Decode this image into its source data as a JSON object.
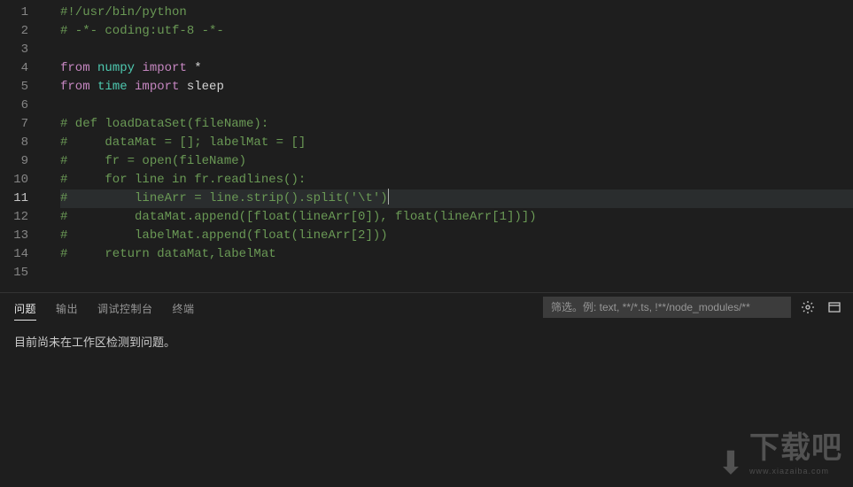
{
  "editor": {
    "active_line": 11,
    "lines": [
      {
        "n": 1,
        "seg": [
          {
            "c": "tk-comment",
            "t": "#!/usr/bin/python"
          }
        ]
      },
      {
        "n": 2,
        "seg": [
          {
            "c": "tk-comment",
            "t": "# -*- coding:utf-8 -*-"
          }
        ]
      },
      {
        "n": 3,
        "seg": [
          {
            "c": "tk-plain",
            "t": ""
          }
        ]
      },
      {
        "n": 4,
        "seg": [
          {
            "c": "tk-keyword",
            "t": "from"
          },
          {
            "c": "tk-plain",
            "t": " "
          },
          {
            "c": "tk-module",
            "t": "numpy"
          },
          {
            "c": "tk-plain",
            "t": " "
          },
          {
            "c": "tk-keyword",
            "t": "import"
          },
          {
            "c": "tk-plain",
            "t": " *"
          }
        ]
      },
      {
        "n": 5,
        "seg": [
          {
            "c": "tk-keyword",
            "t": "from"
          },
          {
            "c": "tk-plain",
            "t": " "
          },
          {
            "c": "tk-module",
            "t": "time"
          },
          {
            "c": "tk-plain",
            "t": " "
          },
          {
            "c": "tk-keyword",
            "t": "import"
          },
          {
            "c": "tk-plain",
            "t": " sleep"
          }
        ]
      },
      {
        "n": 6,
        "seg": [
          {
            "c": "tk-plain",
            "t": ""
          }
        ]
      },
      {
        "n": 7,
        "seg": [
          {
            "c": "tk-comment",
            "t": "# def loadDataSet(fileName):"
          }
        ]
      },
      {
        "n": 8,
        "seg": [
          {
            "c": "tk-comment",
            "t": "#     dataMat = []; labelMat = []"
          }
        ]
      },
      {
        "n": 9,
        "seg": [
          {
            "c": "tk-comment",
            "t": "#     fr = open(fileName)"
          }
        ]
      },
      {
        "n": 10,
        "seg": [
          {
            "c": "tk-comment",
            "t": "#     for line in fr.readlines():"
          }
        ]
      },
      {
        "n": 11,
        "seg": [
          {
            "c": "tk-comment",
            "t": "#         lineArr = line.strip().split('\\t')"
          }
        ],
        "cursor": true
      },
      {
        "n": 12,
        "seg": [
          {
            "c": "tk-comment",
            "t": "#         dataMat.append([float(lineArr[0]), float(lineArr[1])])"
          }
        ]
      },
      {
        "n": 13,
        "seg": [
          {
            "c": "tk-comment",
            "t": "#         labelMat.append(float(lineArr[2]))"
          }
        ]
      },
      {
        "n": 14,
        "seg": [
          {
            "c": "tk-comment",
            "t": "#     return dataMat,labelMat"
          }
        ]
      },
      {
        "n": 15,
        "seg": [
          {
            "c": "tk-plain",
            "t": ""
          }
        ]
      }
    ]
  },
  "panel": {
    "tabs": {
      "problems": "问题",
      "output": "输出",
      "debug_console": "调试控制台",
      "terminal": "终端"
    },
    "filter_placeholder": "筛选。例: text, **/*.ts, !**/node_modules/**",
    "message": "目前尚未在工作区检测到问题。"
  },
  "watermark": {
    "text": "下载吧",
    "sub": "www.xiazaiba.com"
  }
}
